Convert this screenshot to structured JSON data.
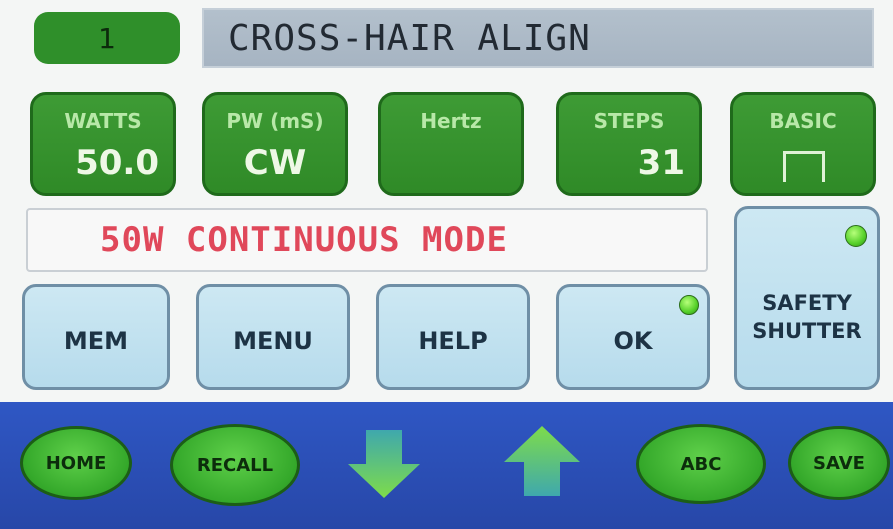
{
  "header": {
    "program_number": "1",
    "title": "CROSS-HAIR ALIGN"
  },
  "params": {
    "watts": {
      "label": "WATTS",
      "value": "50.0"
    },
    "pw": {
      "label": "PW (mS)",
      "value": "CW"
    },
    "hertz": {
      "label": "Hertz",
      "value": ""
    },
    "steps": {
      "label": "STEPS",
      "value": "31"
    },
    "basic": {
      "label": "BASIC",
      "icon": "square-pulse-icon"
    }
  },
  "mode_message": "50W CONTINUOUS MODE",
  "buttons": {
    "mem": "MEM",
    "menu": "MENU",
    "help": "HELP",
    "ok": "OK",
    "safety_line1": "SAFETY",
    "safety_line2": "SHUTTER"
  },
  "footer": {
    "home": "HOME",
    "recall": "RECALL",
    "down_icon": "arrow-down-icon",
    "up_icon": "arrow-up-icon",
    "abc": "ABC",
    "save": "SAVE"
  },
  "colors": {
    "param_green": "#2f8a27",
    "button_blue": "#b6dbec",
    "footer_blue": "#2747a8",
    "mode_text_red": "#e0485a",
    "indicator_green": "#55d02a"
  }
}
